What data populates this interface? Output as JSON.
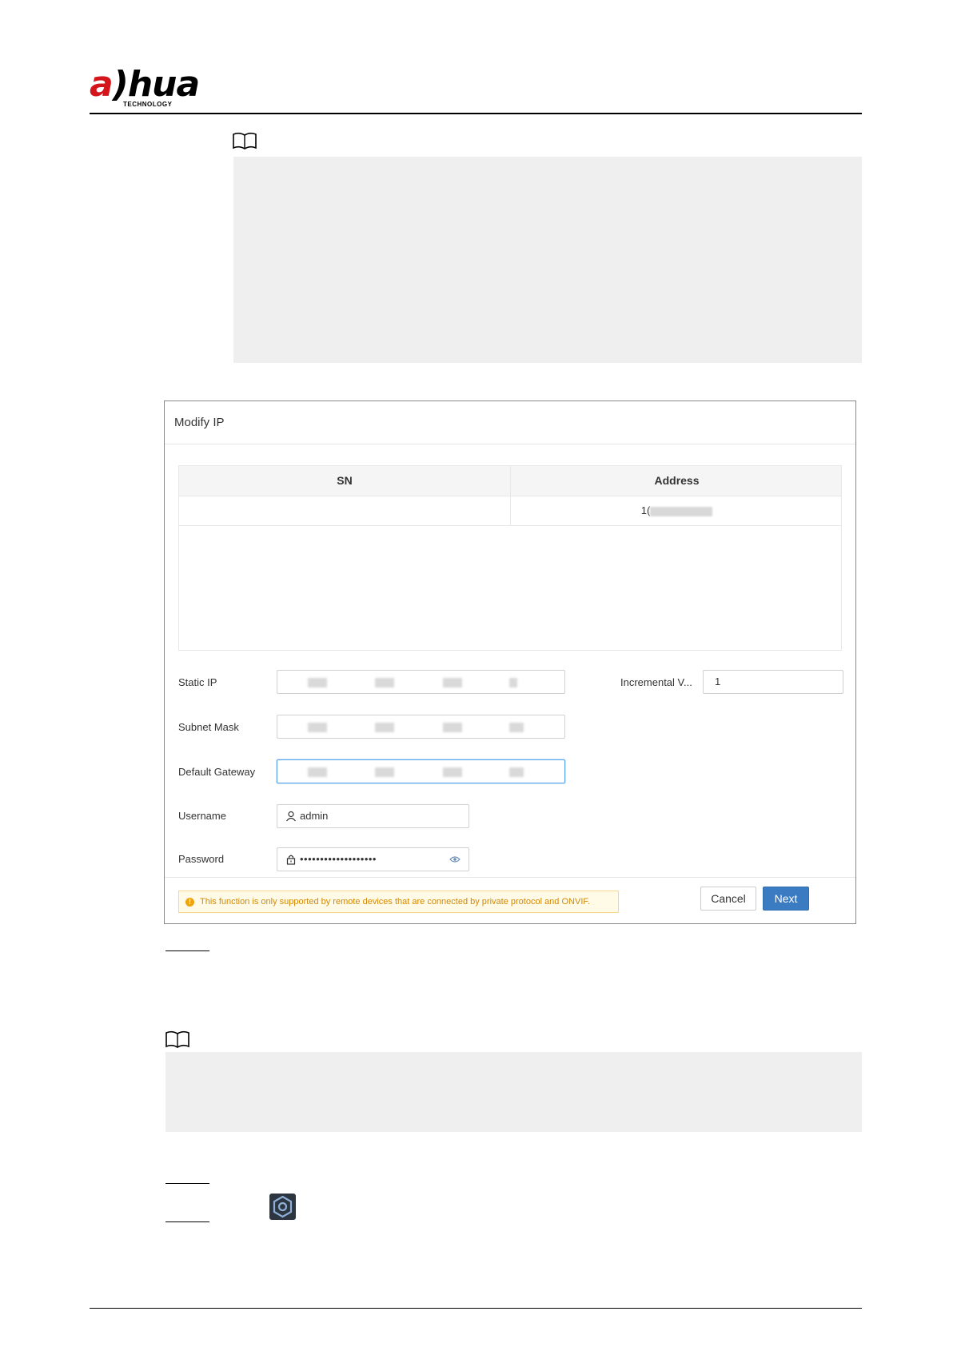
{
  "header": {
    "logo_word": "alhua",
    "logo_sub": "TECHNOLOGY"
  },
  "dialog": {
    "title": "Modify IP",
    "table": {
      "columns": [
        "SN",
        "Address"
      ],
      "rows": [
        {
          "sn": "",
          "address_prefix": "1("
        }
      ]
    },
    "fields": {
      "static_ip_label": "Static IP",
      "subnet_mask_label": "Subnet Mask",
      "default_gateway_label": "Default Gateway",
      "incremental_label": "Incremental V...",
      "incremental_value": "1",
      "username_label": "Username",
      "username_value": "admin",
      "password_label": "Password",
      "password_value": "•••••••••••••••••••"
    },
    "warning": "This function is only supported by remote devices that are connected by private protocol and ONVIF.",
    "buttons": {
      "cancel": "Cancel",
      "next": "Next"
    }
  },
  "icons": {
    "note": "book-note-icon",
    "user": "user-icon",
    "lock": "lock-icon",
    "eye": "eye-icon",
    "gear": "gear-icon",
    "warning": "warning-icon"
  },
  "colors": {
    "brand_red": "#d4161c",
    "primary_button": "#3a7bc2",
    "warning_text": "#d48806",
    "note_background": "#efefef"
  }
}
